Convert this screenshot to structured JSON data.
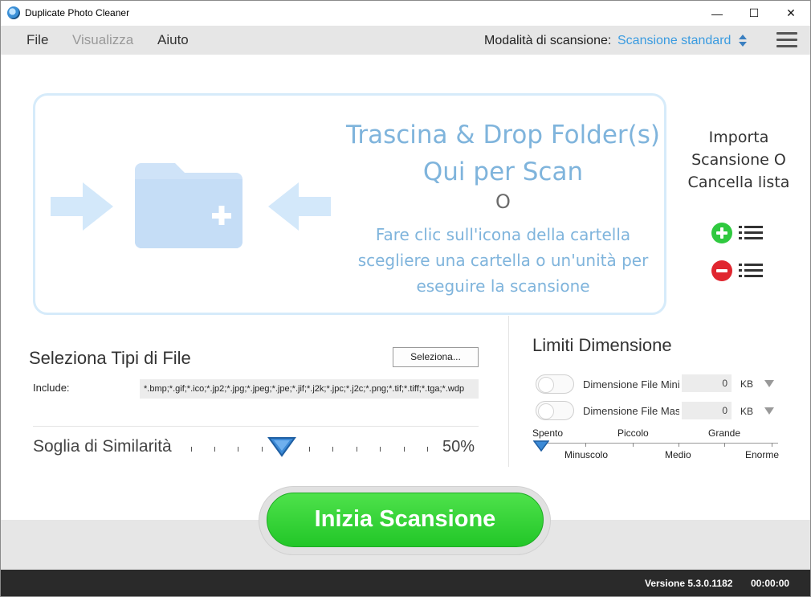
{
  "window": {
    "title": "Duplicate Photo Cleaner",
    "minimize": "—",
    "maximize": "☐",
    "close": "✕"
  },
  "menu": {
    "file": "File",
    "view": "Visualizza",
    "help": "Aiuto",
    "scan_mode_label": "Modalità di scansione:",
    "scan_mode_value": "Scansione standard"
  },
  "dropzone": {
    "title": "Trascina & Drop Folder(s) Qui per Scan",
    "or": "O",
    "subtitle": "Fare clic sull'icona della cartella scegliere una cartella o un'unità per eseguire la scansione"
  },
  "import": {
    "text": "Importa Scansione O Cancella lista"
  },
  "file_types": {
    "title": "Seleziona Tipi di File",
    "select_button": "Seleziona...",
    "include_label": "Include:",
    "include_value": "*.bmp;*.gif;*.ico;*.jp2;*.jpg;*.jpeg;*.jpe;*.jif;*.j2k;*.jpc;*.j2c;*.png;*.tif;*.tiff;*.tga;*.wdp"
  },
  "similarity": {
    "label": "Soglia di Similarità",
    "value": "50%",
    "level": 0.38
  },
  "size_limits": {
    "title": "Limiti Dimensione",
    "min_label": "Dimensione File Minima",
    "min_value": "0",
    "min_unit": "KB",
    "max_label": "Dimensione File Massima",
    "max_value": "0",
    "max_unit": "KB",
    "scale_top": [
      "Spento",
      "Piccolo",
      "Grande"
    ],
    "scale_bottom": [
      "Minuscolo",
      "Medio",
      "Enorme"
    ]
  },
  "start_button": "Inizia Scansione",
  "status": {
    "version": "Versione 5.3.0.1182",
    "timer": "00:00:00"
  },
  "colors": {
    "accent": "#3a9be0",
    "drop_text": "#7fb4dc",
    "start_green": "#2bcb30",
    "status_bar": "#2a2a2a"
  }
}
